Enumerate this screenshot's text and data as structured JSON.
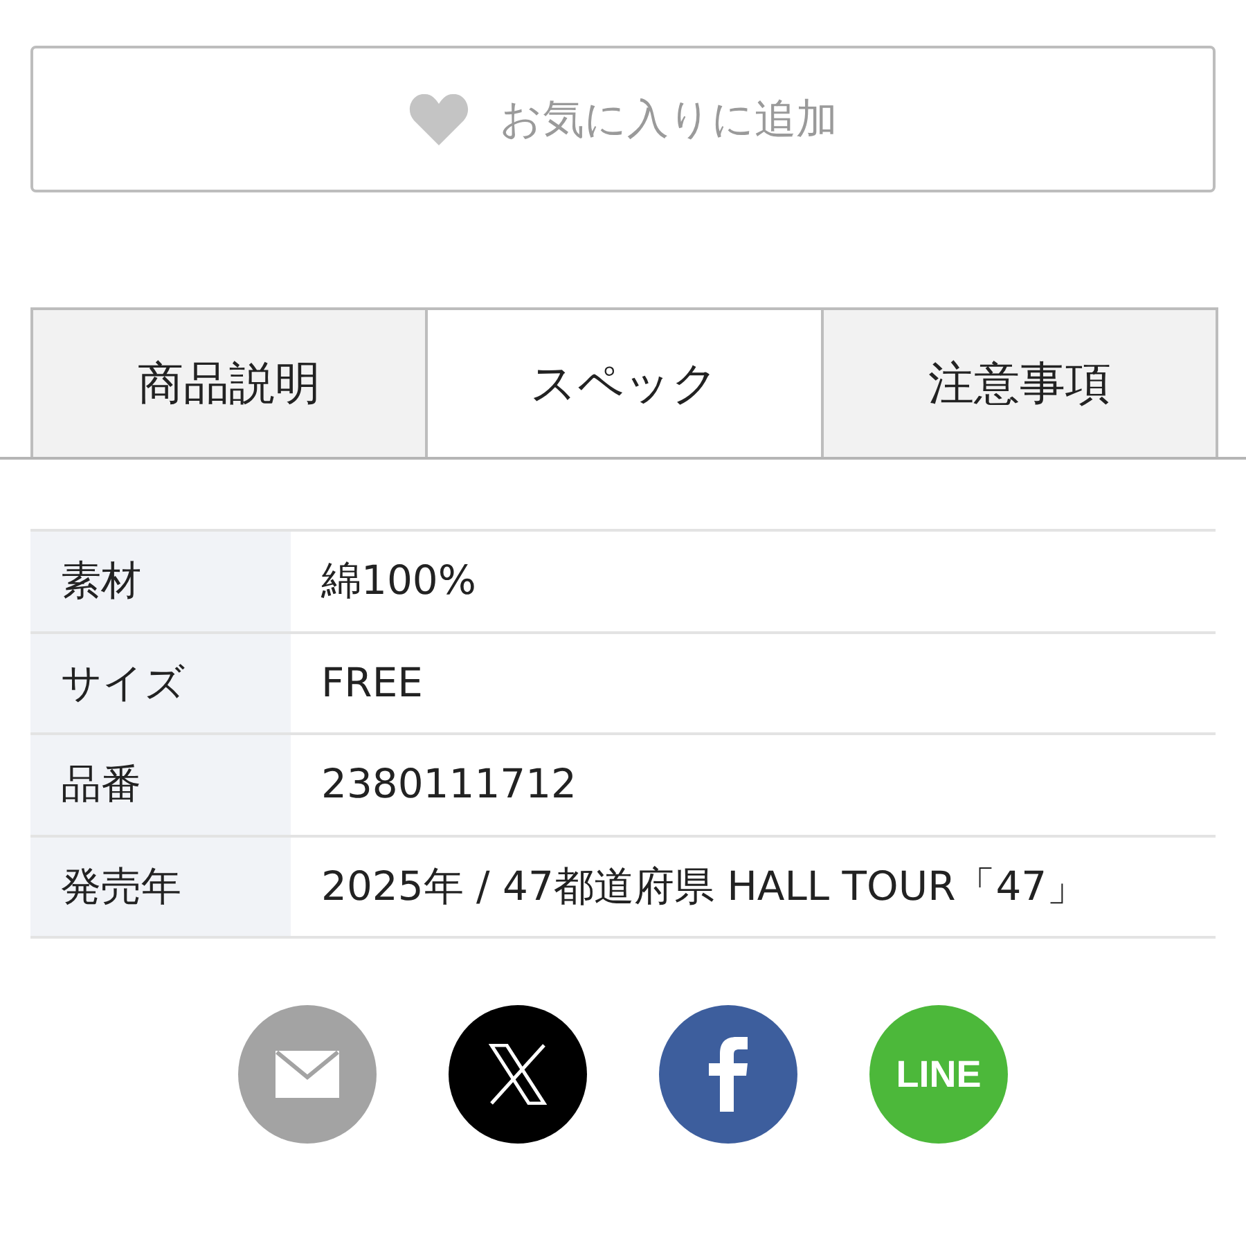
{
  "favorite_button": {
    "label": "お気に入りに追加"
  },
  "tabs": [
    {
      "label": "商品説明",
      "selected": false
    },
    {
      "label": "スペック",
      "selected": true
    },
    {
      "label": "注意事項",
      "selected": false
    }
  ],
  "spec_table": {
    "rows": [
      {
        "label": "素材",
        "value": "綿100%"
      },
      {
        "label": "サイズ",
        "value": "FREE"
      },
      {
        "label": "品番",
        "value": "2380111712"
      },
      {
        "label": "発売年",
        "value": "2025年 / 47都道府県 HALL TOUR「47」"
      }
    ]
  },
  "share_buttons": [
    {
      "kind": "mail"
    },
    {
      "kind": "x"
    },
    {
      "kind": "facebook"
    },
    {
      "kind": "line",
      "label": "LINE"
    }
  ]
}
